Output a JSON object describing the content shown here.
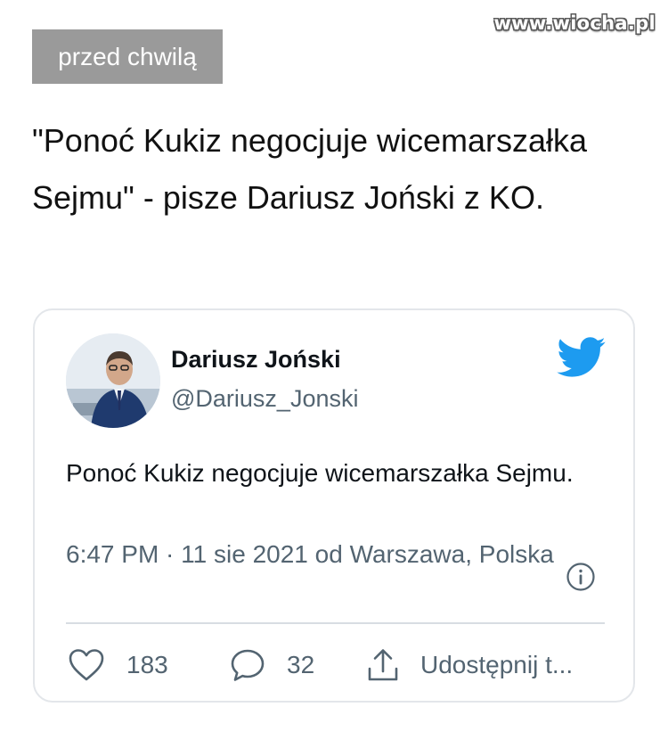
{
  "watermark": "www.wiocha.pl",
  "post": {
    "time_badge": "przed chwilą",
    "headline": "\"Ponoć Kukiz negocjuje wicemarszałka Sejmu\" - pisze Dariusz Joński z KO."
  },
  "tweet": {
    "author_name": "Dariusz Joński",
    "author_handle": "@Dariusz_Jonski",
    "text": "Ponoć Kukiz negocjuje wicemarszałka Sejmu.",
    "meta": "6:47 PM · 11 sie 2021 od Warszawa, Polska",
    "likes": "183",
    "replies": "32",
    "share_label": "Udostępnij t..."
  },
  "colors": {
    "twitter_blue": "#1d9bf0",
    "badge_bg": "#9a9a9a",
    "secondary_text": "#536471"
  },
  "icons": [
    "twitter-bird-icon",
    "info-icon",
    "heart-icon",
    "reply-bubble-icon",
    "share-upload-icon"
  ]
}
